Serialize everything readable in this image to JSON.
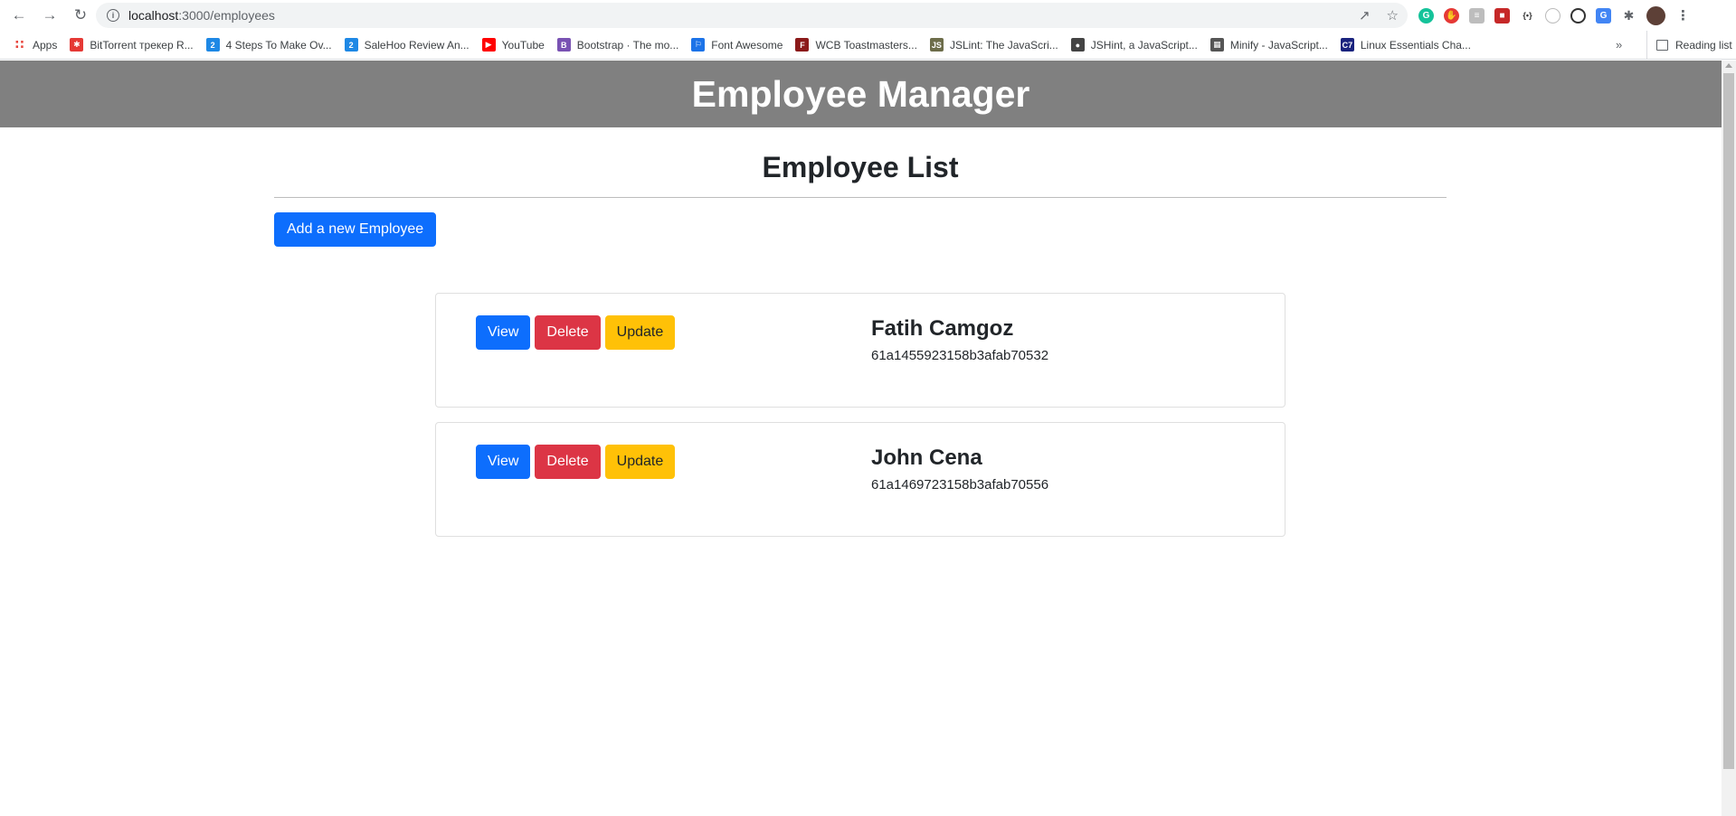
{
  "browser": {
    "url_host": "localhost",
    "url_path": ":3000/employees",
    "bookmarks": [
      {
        "label": "Apps",
        "icon": "apps-grid-icon",
        "color": "#5f6368"
      },
      {
        "label": "BitTorrent трекер R...",
        "icon": "bittorrent-icon",
        "color": "#e53935"
      },
      {
        "label": "4 Steps To Make Ov...",
        "icon": "bracket-2-icon",
        "color": "#1e88e5"
      },
      {
        "label": "SaleHoo Review An...",
        "icon": "bracket-2-icon",
        "color": "#1e88e5"
      },
      {
        "label": "YouTube",
        "icon": "youtube-icon",
        "color": "#ff0000"
      },
      {
        "label": "Bootstrap · The mo...",
        "icon": "bootstrap-icon",
        "color": "#7952b3"
      },
      {
        "label": "Font Awesome",
        "icon": "flag-icon",
        "color": "#1c73e8"
      },
      {
        "label": "WCB Toastmasters...",
        "icon": "fth-icon",
        "color": "#8b1a1a"
      },
      {
        "label": "JSLint: The JavaScri...",
        "icon": "jslint-icon",
        "color": "#6d6d4a"
      },
      {
        "label": "JSHint, a JavaScript...",
        "icon": "globe-icon",
        "color": "#444444"
      },
      {
        "label": "Minify - JavaScript...",
        "icon": "minify-icon",
        "color": "#555555"
      },
      {
        "label": "Linux Essentials Cha...",
        "icon": "c7-icon",
        "color": "#1a237e"
      }
    ],
    "bookmarks_more": "»",
    "reading_list": "Reading list"
  },
  "header": {
    "title": "Employee Manager"
  },
  "main": {
    "title": "Employee List",
    "add_button": "Add a new Employee",
    "employees": [
      {
        "name": "Fatih Camgoz",
        "id": "61a1455923158b3afab70532"
      },
      {
        "name": "John Cena",
        "id": "61a1469723158b3afab70556"
      }
    ],
    "actions": {
      "view": "View",
      "delete": "Delete",
      "update": "Update"
    }
  },
  "colors": {
    "primary": "#0d6efd",
    "danger": "#dc3545",
    "warning": "#ffc107",
    "banner": "#808080"
  }
}
